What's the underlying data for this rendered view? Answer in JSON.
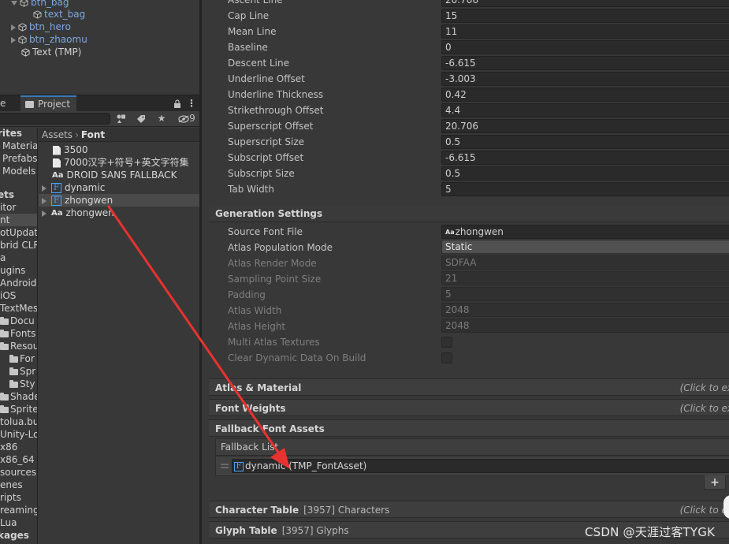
{
  "hierarchy": {
    "items": [
      {
        "label": "btn_bag"
      },
      {
        "label": "text_bag"
      },
      {
        "label": "btn_hero"
      },
      {
        "label": "btn_zhaomu"
      },
      {
        "label": "Text (TMP)"
      }
    ]
  },
  "project": {
    "tab_left": "e",
    "tab_active": "Project",
    "hidden_count": "9",
    "favorites": [
      {
        "label": "rites"
      },
      {
        "label": "Materia"
      },
      {
        "label": "Prefabs"
      },
      {
        "label": "Models"
      }
    ],
    "tree": [
      {
        "label": "ets"
      },
      {
        "label": "itor"
      },
      {
        "label": "nt"
      },
      {
        "label": "otUpdate"
      },
      {
        "label": "brid CLR"
      },
      {
        "label": "a"
      },
      {
        "label": "ugins"
      },
      {
        "label": "Android"
      },
      {
        "label": "iOS"
      },
      {
        "label": "TextMes"
      },
      {
        "label": "Docu"
      },
      {
        "label": "Fonts"
      },
      {
        "label": "Resou"
      },
      {
        "label": "For"
      },
      {
        "label": "Spr"
      },
      {
        "label": "Sty"
      },
      {
        "label": "Shade"
      },
      {
        "label": "Sprite"
      },
      {
        "label": "tolua.bu"
      },
      {
        "label": "Unity-Lo"
      },
      {
        "label": "x86"
      },
      {
        "label": "x86_64"
      },
      {
        "label": "sources"
      },
      {
        "label": "enes"
      },
      {
        "label": "ripts"
      },
      {
        "label": "reamingA"
      },
      {
        "label": "Lua"
      },
      {
        "label": "kages"
      }
    ],
    "breadcrumb": [
      "Assets",
      "Font"
    ],
    "assets": [
      {
        "label": "3500"
      },
      {
        "label": "7000汉字+符号+英文字符集"
      },
      {
        "label": "DROID SANS FALLBACK"
      },
      {
        "label": "dynamic"
      },
      {
        "label": "zhongwen"
      },
      {
        "label": "zhongwen"
      }
    ],
    "aa_icon": "Aa",
    "f_icon": "F"
  },
  "inspector": {
    "face_info": [
      {
        "label": "Ascent Line",
        "value": "20.706"
      },
      {
        "label": "Cap Line",
        "value": "15"
      },
      {
        "label": "Mean Line",
        "value": "11"
      },
      {
        "label": "Baseline",
        "value": "0"
      },
      {
        "label": "Descent Line",
        "value": "-6.615"
      },
      {
        "label": "Underline Offset",
        "value": "-3.003"
      },
      {
        "label": "Underline Thickness",
        "value": "0.42"
      },
      {
        "label": "Strikethrough Offset",
        "value": "4.4"
      },
      {
        "label": "Superscript Offset",
        "value": "20.706"
      },
      {
        "label": "Superscript Size",
        "value": "0.5"
      },
      {
        "label": "Subscript Offset",
        "value": "-6.615"
      },
      {
        "label": "Subscript Size",
        "value": "0.5"
      },
      {
        "label": "Tab Width",
        "value": "5"
      }
    ],
    "generation_settings": {
      "title": "Generation Settings",
      "source_font_file_label": "Source Font File",
      "source_font_file_value": "zhongwen",
      "atlas_population_mode_label": "Atlas Population Mode",
      "atlas_population_mode_value": "Static",
      "atlas_render_mode_label": "Atlas Render Mode",
      "atlas_render_mode_value": "SDFAA",
      "sampling_point_size_label": "Sampling Point Size",
      "sampling_point_size_value": "21",
      "padding_label": "Padding",
      "padding_value": "5",
      "atlas_width_label": "Atlas Width",
      "atlas_width_value": "2048",
      "atlas_height_label": "Atlas Height",
      "atlas_height_value": "2048",
      "multi_atlas_label": "Multi Atlas Textures",
      "clear_dynamic_label": "Clear Dynamic Data On Build"
    },
    "atlas_material": {
      "title": "Atlas & Material",
      "hint": "(Click to ex"
    },
    "font_weights": {
      "title": "Font Weights",
      "hint": "(Click to ex"
    },
    "fallback": {
      "title": "Fallback Font Assets",
      "list_label": "Fallback List",
      "item": "dynamic (TMP_FontAsset)",
      "plus": "+"
    },
    "character_table": {
      "title": "Character Table",
      "extra": "[3957] Characters",
      "hint": "(Click to ex"
    },
    "glyph_table": {
      "title": "Glyph Table",
      "extra": "[3957] Glyphs"
    }
  },
  "watermark": "CSDN @天涯过客TYGK",
  "colors": {
    "arrow": "#e8322f",
    "accent": "#3a79bb",
    "link": "#7da9e0"
  }
}
